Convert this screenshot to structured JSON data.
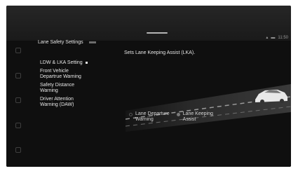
{
  "header": {
    "title": "Lane Safety Settings"
  },
  "description": "Sets Lane Keeping Assist (LKA).",
  "status": {
    "time": "11:50"
  },
  "menu": [
    {
      "lines": [
        "LDW & LKA Setting"
      ],
      "selected": true
    },
    {
      "lines": [
        "Front Vehicle",
        "Departrue Warning"
      ],
      "selected": false
    },
    {
      "lines": [
        "Safety Distance",
        "Warning"
      ],
      "selected": false
    },
    {
      "lines": [
        "Driver Attention",
        "Warning (DAW)"
      ],
      "selected": false
    }
  ],
  "options": [
    {
      "lines": [
        "Lane Departure",
        "Warning"
      ],
      "selected": false
    },
    {
      "lines": [
        "Lane Keeping",
        "Assist"
      ],
      "selected": true
    }
  ],
  "colors": {
    "background": "#151515",
    "text": "#e6e6e6",
    "road": "#2a2a2a"
  }
}
